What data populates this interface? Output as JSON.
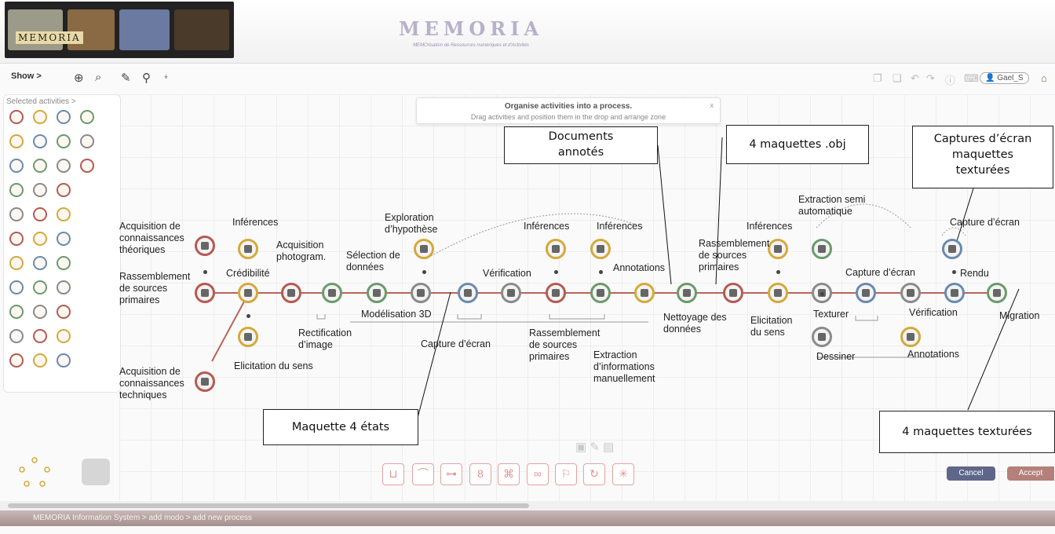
{
  "header": {
    "logo_text": "MEMORIA",
    "title": "MEMORIA",
    "subtitle": "MEMOrisation de Ressources numériques et d'Activités"
  },
  "toolbar": {
    "show_label": "Show >",
    "user_label": "Gael_S"
  },
  "palette": {
    "label": "Selected activities >"
  },
  "help": {
    "title": "Organise activities into a process.",
    "text": "Drag activities and position them in the drop and arrange zone",
    "close": "x"
  },
  "labels": {
    "acq_theo": "Acquisition de\nconnaissances\nthéoriques",
    "rass1": "Rassemblement\nde sources\nprimaires",
    "acq_tech": "Acquisition de\nconnaissances\ntechniques",
    "inferences1": "Inférences",
    "credibilite": "Crédibilité",
    "elicitation1": "Elicitation du sens",
    "acq_photo": "Acquisition\nphotogram.",
    "rectification": "Rectification\nd’image",
    "selection": "Sélection de\ndonnées",
    "exploration": "Exploration\nd’hypothèse",
    "modelisation": "Modélisation 3D",
    "capture1": "Capture d’écran",
    "verification1": "Vérification",
    "inferences2": "Inférences",
    "inferences3": "Inférences",
    "rass2": "Rassemblement\nde sources\nprimaires",
    "extraction_man": "Extraction\nd’informations\nmanuellement",
    "annotations1": "Annotations",
    "nettoyage": "Nettoyage des\ndonnées",
    "rass3": "Rassemblement\nde sources\nprimaires",
    "elicitation2": "Elicitation\ndu sens",
    "inferences4": "Inférences",
    "extraction_semi": "Extraction semi\nautomatique",
    "capture2": "Capture d’écran",
    "texturer": "Texturer",
    "dessiner": "Dessiner",
    "verification2": "Vérification",
    "annotations2": "Annotations",
    "capture3": "Capture d’écran",
    "rendu": "Rendu",
    "migration": "Migration"
  },
  "callouts": {
    "docs": "Documents\nannotés",
    "obj": "4 maquettes .obj",
    "captures": "Captures d’écran\nmaquettes\ntexturées",
    "maquette4": "Maquette 4 états",
    "maquettes_tex": "4 maquettes texturées"
  },
  "buttons": {
    "cancel": "Cancel",
    "accept": "Accept"
  },
  "status": {
    "breadcrumb": "MEMORIA Information System > add modo > add new process"
  },
  "colors": {
    "red": "#b55a52",
    "gold": "#d4a93b",
    "green": "#6b9a6a",
    "blue": "#6a8ab0",
    "cancel": "#5e6789",
    "accept": "#b48079",
    "statusbar": "#a58f8c"
  }
}
